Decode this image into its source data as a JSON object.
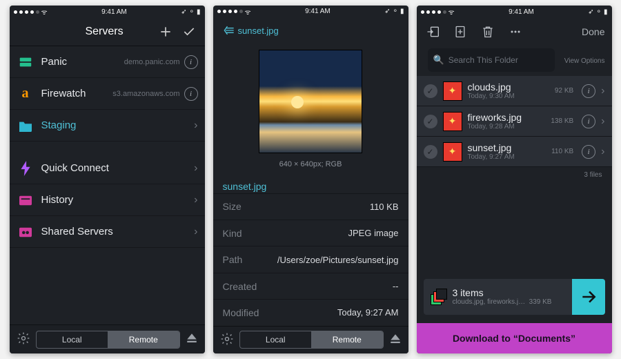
{
  "status": {
    "time": "9:41 AM"
  },
  "screen1": {
    "title": "Servers",
    "servers": [
      {
        "name": "Panic",
        "host": "demo.panic.com"
      },
      {
        "name": "Firewatch",
        "host": "s3.amazonaws.com"
      },
      {
        "name": "Staging",
        "host": ""
      }
    ],
    "extras": [
      {
        "name": "Quick Connect"
      },
      {
        "name": "History"
      },
      {
        "name": "Shared Servers"
      }
    ],
    "toolbar": {
      "local": "Local",
      "remote": "Remote"
    }
  },
  "screen2": {
    "crumb": "sunset.jpg",
    "dimensions": "640 × 640px; RGB",
    "filename": "sunset.jpg",
    "props": {
      "size_k": "Size",
      "size_v": "110 KB",
      "kind_k": "Kind",
      "kind_v": "JPEG image",
      "path_k": "Path",
      "path_v": "/Users/zoe/Pictures/sunset.jpg",
      "created_k": "Created",
      "created_v": "--",
      "modified_k": "Modified",
      "modified_v": "Today, 9:27 AM"
    },
    "toolbar": {
      "local": "Local",
      "remote": "Remote"
    }
  },
  "screen3": {
    "done": "Done",
    "search_placeholder": "Search This Folder",
    "view_options": "View Options",
    "files": [
      {
        "name": "clouds.jpg",
        "time": "Today, 9:30 AM",
        "size": "92 KB"
      },
      {
        "name": "fireworks.jpg",
        "time": "Today, 9:28 AM",
        "size": "138 KB"
      },
      {
        "name": "sunset.jpg",
        "time": "Today, 9:27 AM",
        "size": "110 KB"
      }
    ],
    "count": "3 files",
    "tray": {
      "title": "3 items",
      "sub": "clouds.jpg, fireworks.j…",
      "size": "339 KB"
    },
    "download": "Download to “Documents”"
  }
}
